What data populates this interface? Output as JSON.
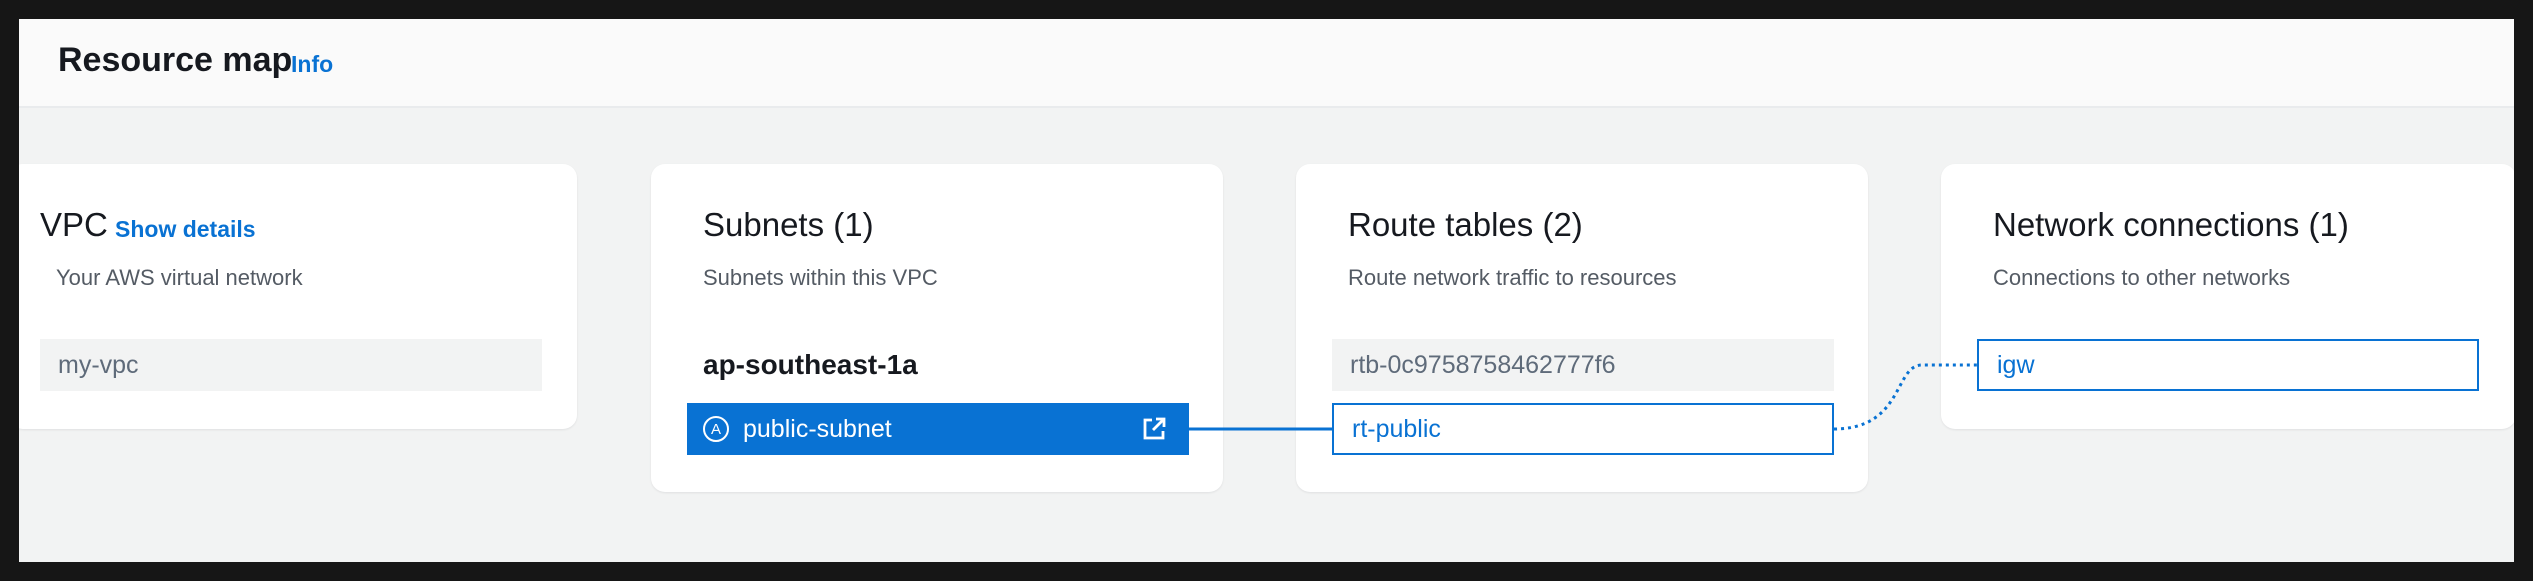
{
  "header": {
    "title": "Resource map",
    "info_label": "Info"
  },
  "vpc": {
    "title": "VPC",
    "show_details": "Show details",
    "description": "Your AWS virtual network",
    "items": [
      {
        "label": "my-vpc"
      }
    ]
  },
  "subnets": {
    "title": "Subnets (1)",
    "description": "Subnets within this VPC",
    "az_label": "ap-southeast-1a",
    "az_badge": "A",
    "items": [
      {
        "label": "public-subnet",
        "icon": "external-link-icon"
      }
    ]
  },
  "route_tables": {
    "title": "Route tables (2)",
    "description": "Route network traffic to resources",
    "items": [
      {
        "label": "rtb-0c9758758462777f6"
      },
      {
        "label": "rt-public"
      }
    ]
  },
  "network_connections": {
    "title": "Network connections (1)",
    "description": "Connections to other networks",
    "items": [
      {
        "label": "igw"
      }
    ]
  },
  "colors": {
    "accent": "#0972d3",
    "selected_bg": "#0972d3",
    "gray_node": "#f2f3f3",
    "page_bg": "#f2f3f3"
  }
}
